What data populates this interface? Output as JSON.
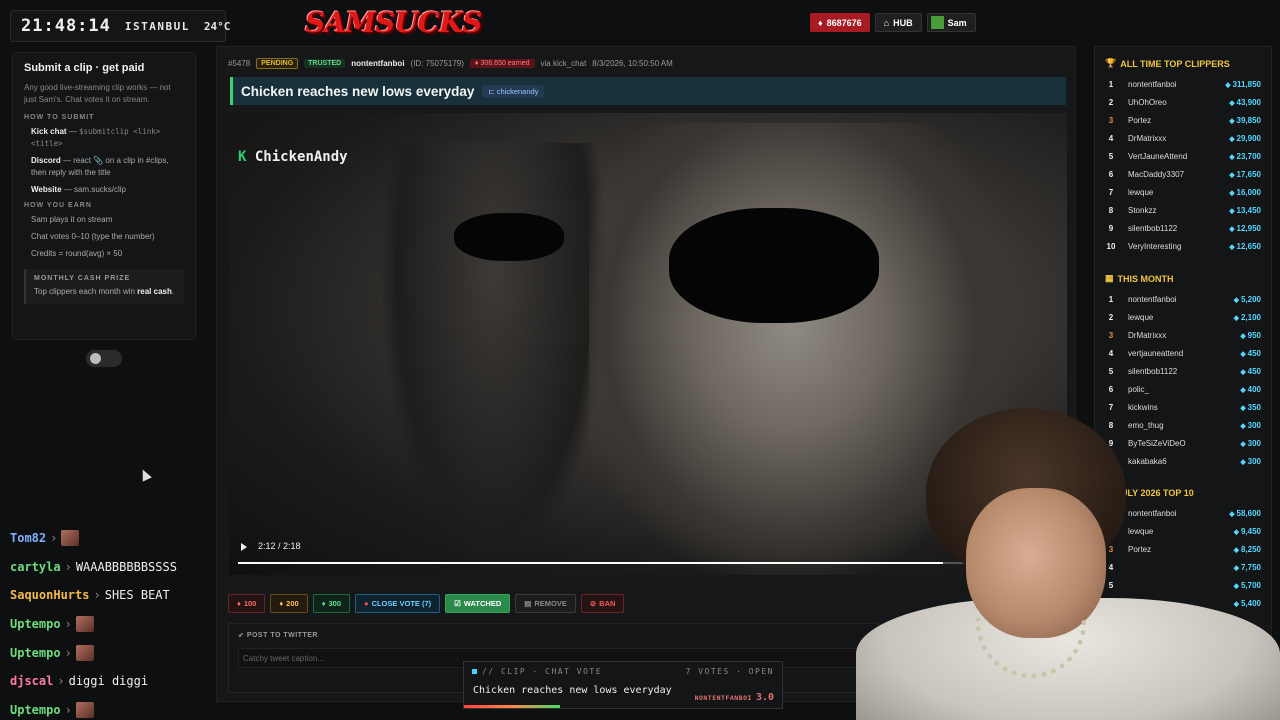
{
  "clock": {
    "time": "21:48:14",
    "city": "ISTANBUL",
    "temp": "24°C"
  },
  "logo": "SAMSUCKS",
  "top": {
    "gems": "8687676",
    "hub": "HUB",
    "user": "Sam"
  },
  "submit": {
    "title": "Submit a clip · get paid",
    "desc": "Any good live-streaming clip works — not just Sam's. Chat votes it on stream.",
    "how_submit_h": "HOW TO SUBMIT",
    "kick_label": "Kick chat",
    "kick_text": " — ",
    "kick_code": "$submitclip <link> <title>",
    "discord_label": "Discord",
    "discord_text": " — react 📎 on a clip in #clips, then reply with the title",
    "website_label": "Website",
    "website_text": " — sam.sucks/clip",
    "how_earn_h": "HOW YOU EARN",
    "earn": [
      "Sam plays it on stream",
      "Chat votes 0–10 (type the number)",
      "Credits = round(avg) × 50"
    ],
    "prize_h": "MONTHLY CASH PRIZE",
    "prize_text": "Top clippers each month win ",
    "prize_bold": "real cash",
    "prize_end": "."
  },
  "chat": [
    {
      "user": "Tom82",
      "msg": "",
      "emote": true
    },
    {
      "user": "cartyla",
      "msg": "WAAABBBBBBSSSS",
      "emote": false
    },
    {
      "user": "SaquonHurts",
      "msg": "SHES BEAT",
      "emote": false
    },
    {
      "user": "Uptempo",
      "msg": "",
      "emote": true
    },
    {
      "user": "Uptempo",
      "msg": "",
      "emote": true
    },
    {
      "user": "djscal",
      "msg": "diggi diggi",
      "emote": false
    },
    {
      "user": "Uptempo",
      "msg": "",
      "emote": true
    }
  ],
  "clip": {
    "id": "#5478",
    "status": "PENDING",
    "trust": "TRUSTED",
    "user": "nontentfanboi",
    "user_id": "(ID: 75075179)",
    "earned": "306,650 earned",
    "via": "via kick_chat",
    "date": "8/3/2026, 10:50:50 AM",
    "title": "Chicken reaches new lows everyday",
    "channel": "chickenandy",
    "video_logo_k": "K",
    "video_logo": "ChickenAndy",
    "time": "2:12 / 2:18",
    "progress": 0.86
  },
  "actions": {
    "v100": "100",
    "v200": "200",
    "v300": "300",
    "close": "CLOSE VOTE (7)",
    "watched": "WATCHED",
    "remove": "REMOVE",
    "ban": "BAN"
  },
  "tweet": {
    "header": "POST TO TWITTER",
    "placeholder": "Catchy tweet caption..."
  },
  "vote": {
    "label": "// CLIP · CHAT VOTE",
    "status": "7 VOTES · OPEN",
    "title": "Chicken reaches new lows everyday",
    "user": "NONTENTFANBOI",
    "score": "3.0"
  },
  "leaderboards": {
    "alltime": {
      "title": "ALL TIME TOP CLIPPERS",
      "rows": [
        {
          "rank": "1",
          "name": "nontentfanboi",
          "score": "311,850"
        },
        {
          "rank": "2",
          "name": "UhOhOreo",
          "score": "43,900"
        },
        {
          "rank": "3",
          "name": "Portez",
          "score": "39,850"
        },
        {
          "rank": "4",
          "name": "DrMatrixxx",
          "score": "29,900"
        },
        {
          "rank": "5",
          "name": "VertJauneAttend",
          "score": "23,700"
        },
        {
          "rank": "6",
          "name": "MacDaddy3307",
          "score": "17,650"
        },
        {
          "rank": "7",
          "name": "lewque",
          "score": "16,000"
        },
        {
          "rank": "8",
          "name": "Stonkzz",
          "score": "13,450"
        },
        {
          "rank": "9",
          "name": "silentbob1122",
          "score": "12,950"
        },
        {
          "rank": "10",
          "name": "VeryInteresting",
          "score": "12,650"
        }
      ]
    },
    "month": {
      "title": "THIS MONTH",
      "rows": [
        {
          "rank": "1",
          "name": "nontentfanboi",
          "score": "5,200"
        },
        {
          "rank": "2",
          "name": "lewque",
          "score": "2,100"
        },
        {
          "rank": "3",
          "name": "DrMatrixxx",
          "score": "950"
        },
        {
          "rank": "4",
          "name": "vertjauneattend",
          "score": "450"
        },
        {
          "rank": "5",
          "name": "silentbob1122",
          "score": "450"
        },
        {
          "rank": "6",
          "name": "polic_",
          "score": "400"
        },
        {
          "rank": "7",
          "name": "kickwins",
          "score": "350"
        },
        {
          "rank": "8",
          "name": "emo_thug",
          "score": "300"
        },
        {
          "rank": "9",
          "name": "ByTeSiZeViDeO",
          "score": "300"
        },
        {
          "rank": "10",
          "name": "kakabaka6",
          "score": "300"
        }
      ]
    },
    "july": {
      "title": "ULY 2026 TOP 10",
      "rows": [
        {
          "rank": "1",
          "name": "nontentfanboi",
          "score": "58,600"
        },
        {
          "rank": "2",
          "name": "lewque",
          "score": "9,450"
        },
        {
          "rank": "3",
          "name": "Portez",
          "score": "8,250"
        },
        {
          "rank": "4",
          "name": "",
          "score": "7,750"
        },
        {
          "rank": "5",
          "name": "",
          "score": "5,700"
        },
        {
          "rank": "6",
          "name": "",
          "score": "5,400"
        }
      ]
    }
  }
}
